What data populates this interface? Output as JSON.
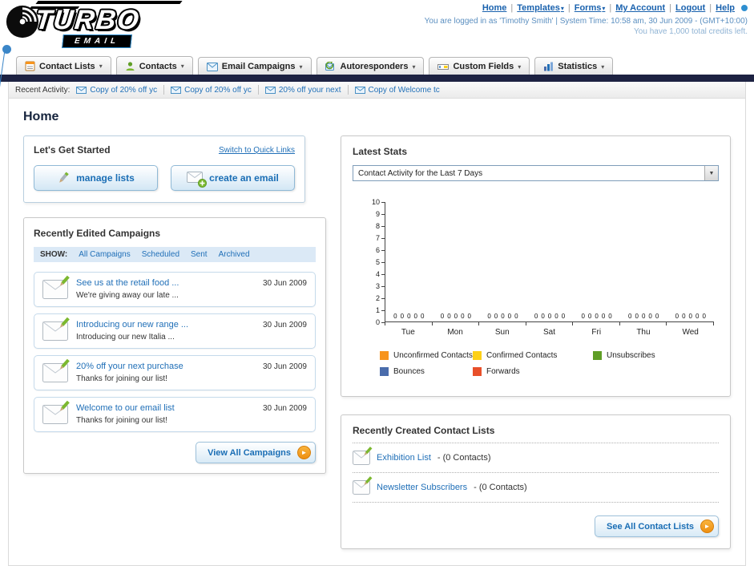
{
  "icons": {
    "caret_down": "▾",
    "select_arrow": "▼",
    "arrow_right": "►"
  },
  "header": {
    "logo_title": "TURBO",
    "logo_subtitle": "EMAIL",
    "links": [
      "Home",
      "Templates",
      "Forms",
      "My Account",
      "Logout",
      "Help"
    ],
    "login_info": "You are logged in as 'Timothy Smith' | System Time: 10:58 am, 30 Jun 2009 - (GMT+10:00)",
    "credits_info": "You have 1,000 total credits left."
  },
  "nav_tabs": [
    {
      "label": "Contact Lists"
    },
    {
      "label": "Contacts"
    },
    {
      "label": "Email Campaigns"
    },
    {
      "label": "Autoresponders"
    },
    {
      "label": "Custom Fields"
    },
    {
      "label": "Statistics"
    }
  ],
  "recent_activity": {
    "label": "Recent Activity:",
    "items": [
      "Copy of 20% off yc",
      "Copy of 20% off yc",
      "20% off your next",
      "Copy of Welcome tc"
    ]
  },
  "page_title": "Home",
  "get_started": {
    "title": "Let's Get Started",
    "switch_link": "Switch to Quick Links",
    "manage_lists_label": "manage lists",
    "create_email_label": "create an email"
  },
  "campaigns": {
    "title": "Recently Edited Campaigns",
    "show_label": "SHOW:",
    "filters": [
      "All Campaigns",
      "Scheduled",
      "Sent",
      "Archived"
    ],
    "items": [
      {
        "title": "See us at the retail food ...",
        "subtitle": "We're giving away our late ...",
        "date": "30 Jun 2009"
      },
      {
        "title": "Introducing our new range ...",
        "subtitle": "Introducing our new Italia ...",
        "date": "30 Jun 2009"
      },
      {
        "title": "20% off your next purchase",
        "subtitle": "Thanks for joining our list!",
        "date": "30 Jun 2009"
      },
      {
        "title": "Welcome to our email list",
        "subtitle": "Thanks for joining our list!",
        "date": "30 Jun 2009"
      }
    ],
    "view_all_label": "View All Campaigns"
  },
  "latest_stats": {
    "title": "Latest Stats",
    "period_selector": "Contact Activity for the Last 7 Days",
    "chart_data": {
      "type": "bar",
      "title": "Contact Activity for the Last 7 Days",
      "categories": [
        "Tue",
        "Mon",
        "Sun",
        "Sat",
        "Fri",
        "Thu",
        "Wed"
      ],
      "series": [
        {
          "name": "Unconfirmed Contacts",
          "color": "#f7941d",
          "values": [
            0,
            0,
            0,
            0,
            0,
            0,
            0
          ]
        },
        {
          "name": "Confirmed Contacts",
          "color": "#fdd017",
          "values": [
            0,
            0,
            0,
            0,
            0,
            0,
            0
          ]
        },
        {
          "name": "Unsubscribes",
          "color": "#5f9e26",
          "values": [
            0,
            0,
            0,
            0,
            0,
            0,
            0
          ]
        },
        {
          "name": "Bounces",
          "color": "#4a6cab",
          "values": [
            0,
            0,
            0,
            0,
            0,
            0,
            0
          ]
        },
        {
          "name": "Forwards",
          "color": "#e8502a",
          "values": [
            0,
            0,
            0,
            0,
            0,
            0,
            0
          ]
        }
      ],
      "ylim": [
        0,
        10
      ],
      "legend_position": "bottom",
      "value_labels_shown": true
    }
  },
  "contact_lists": {
    "title": "Recently Created Contact Lists",
    "items": [
      {
        "name": "Exhibition List",
        "detail": "- (0 Contacts)"
      },
      {
        "name": "Newsletter Subscribers",
        "detail": "- (0 Contacts)"
      }
    ],
    "see_all_label": "See All Contact Lists"
  }
}
